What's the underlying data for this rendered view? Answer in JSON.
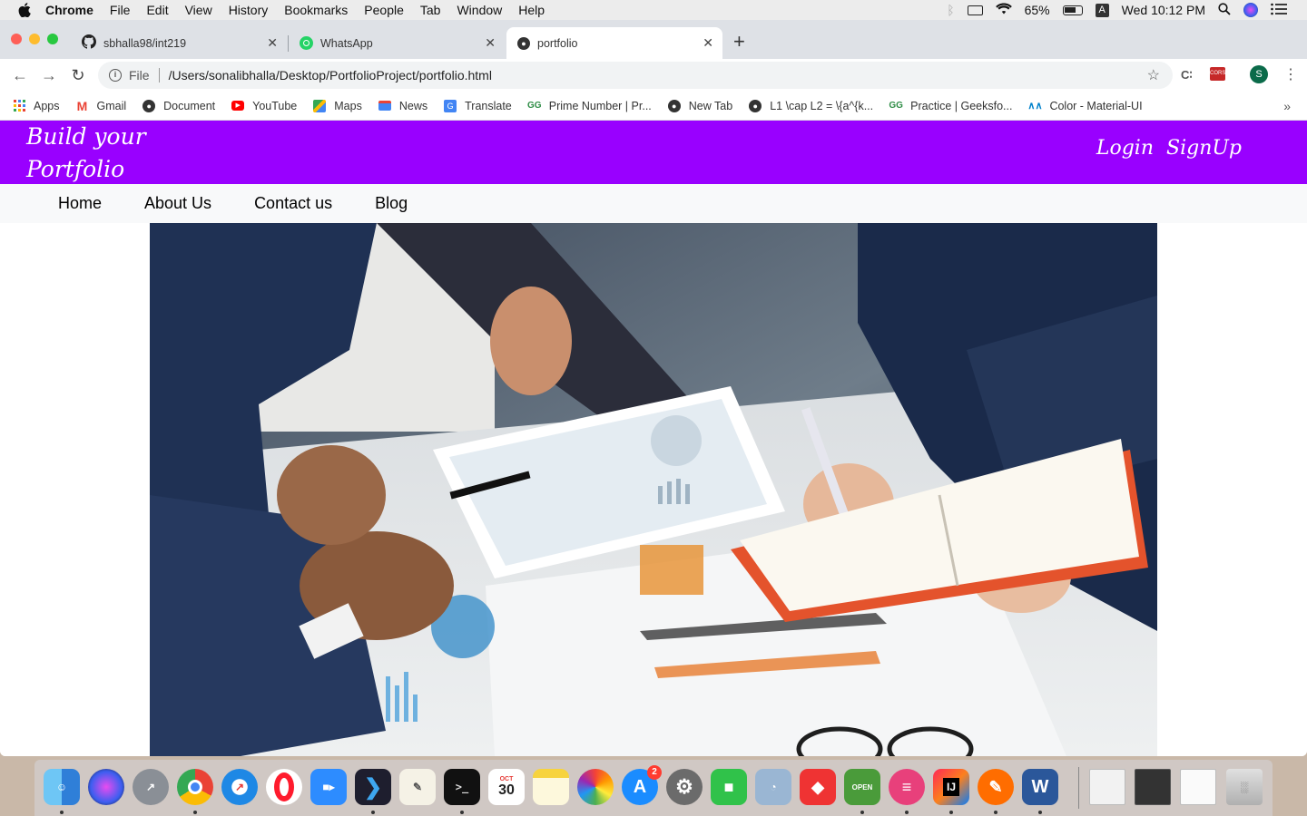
{
  "menubar": {
    "app": "Chrome",
    "items": [
      "File",
      "Edit",
      "View",
      "History",
      "Bookmarks",
      "People",
      "Tab",
      "Window",
      "Help"
    ],
    "battery": "65%",
    "input_source": "A",
    "clock": "Wed 10:12 PM"
  },
  "tabs": [
    {
      "title": "sbhalla98/int219",
      "icon": "github-icon"
    },
    {
      "title": "WhatsApp",
      "icon": "whatsapp-icon"
    },
    {
      "title": "portfolio",
      "icon": "globe-icon",
      "active": true
    }
  ],
  "address_bar": {
    "scheme": "File",
    "url": "/Users/sonalibhalla/Desktop/PortfolioProject/portfolio.html"
  },
  "profile_initial": "S",
  "bookmarks": [
    {
      "label": "Apps",
      "icon": "apps-grid-icon"
    },
    {
      "label": "Gmail",
      "icon": "gmail-icon"
    },
    {
      "label": "Document",
      "icon": "globe-icon"
    },
    {
      "label": "YouTube",
      "icon": "youtube-icon"
    },
    {
      "label": "Maps",
      "icon": "maps-icon"
    },
    {
      "label": "News",
      "icon": "news-icon"
    },
    {
      "label": "Translate",
      "icon": "translate-icon"
    },
    {
      "label": "Prime Number | Pr...",
      "icon": "geeksforgeeks-icon"
    },
    {
      "label": "New Tab",
      "icon": "globe-icon"
    },
    {
      "label": "L1 \\cap L2 = \\{a^{k...",
      "icon": "globe-icon"
    },
    {
      "label": "Practice | Geeksfo...",
      "icon": "geeksforgeeks-icon"
    },
    {
      "label": "Color - Material-UI",
      "icon": "material-ui-icon"
    }
  ],
  "site": {
    "brand_line1": "Build your",
    "brand_line2": "Portfolio",
    "login": "Login",
    "signup": "SignUp",
    "nav": [
      "Home",
      "About Us",
      "Contact us",
      "Blog"
    ],
    "colors": {
      "header": "#9900ff",
      "nav_bg": "#f8f9fa"
    }
  },
  "dock": {
    "apps": [
      "finder",
      "siri",
      "launchpad",
      "chrome",
      "safari",
      "opera",
      "zoom",
      "vscode",
      "textedit",
      "terminal",
      "calendar",
      "notes",
      "photos",
      "app-store",
      "system-preferences",
      "facetime",
      "preview",
      "anydesk",
      "open",
      "archive",
      "intellij",
      "sublime",
      "word"
    ],
    "calendar_month": "OCT",
    "calendar_day": "30",
    "app_store_badge": "2",
    "open_label": "OPEN",
    "intellij_label": "IJ",
    "word_label": "W"
  }
}
